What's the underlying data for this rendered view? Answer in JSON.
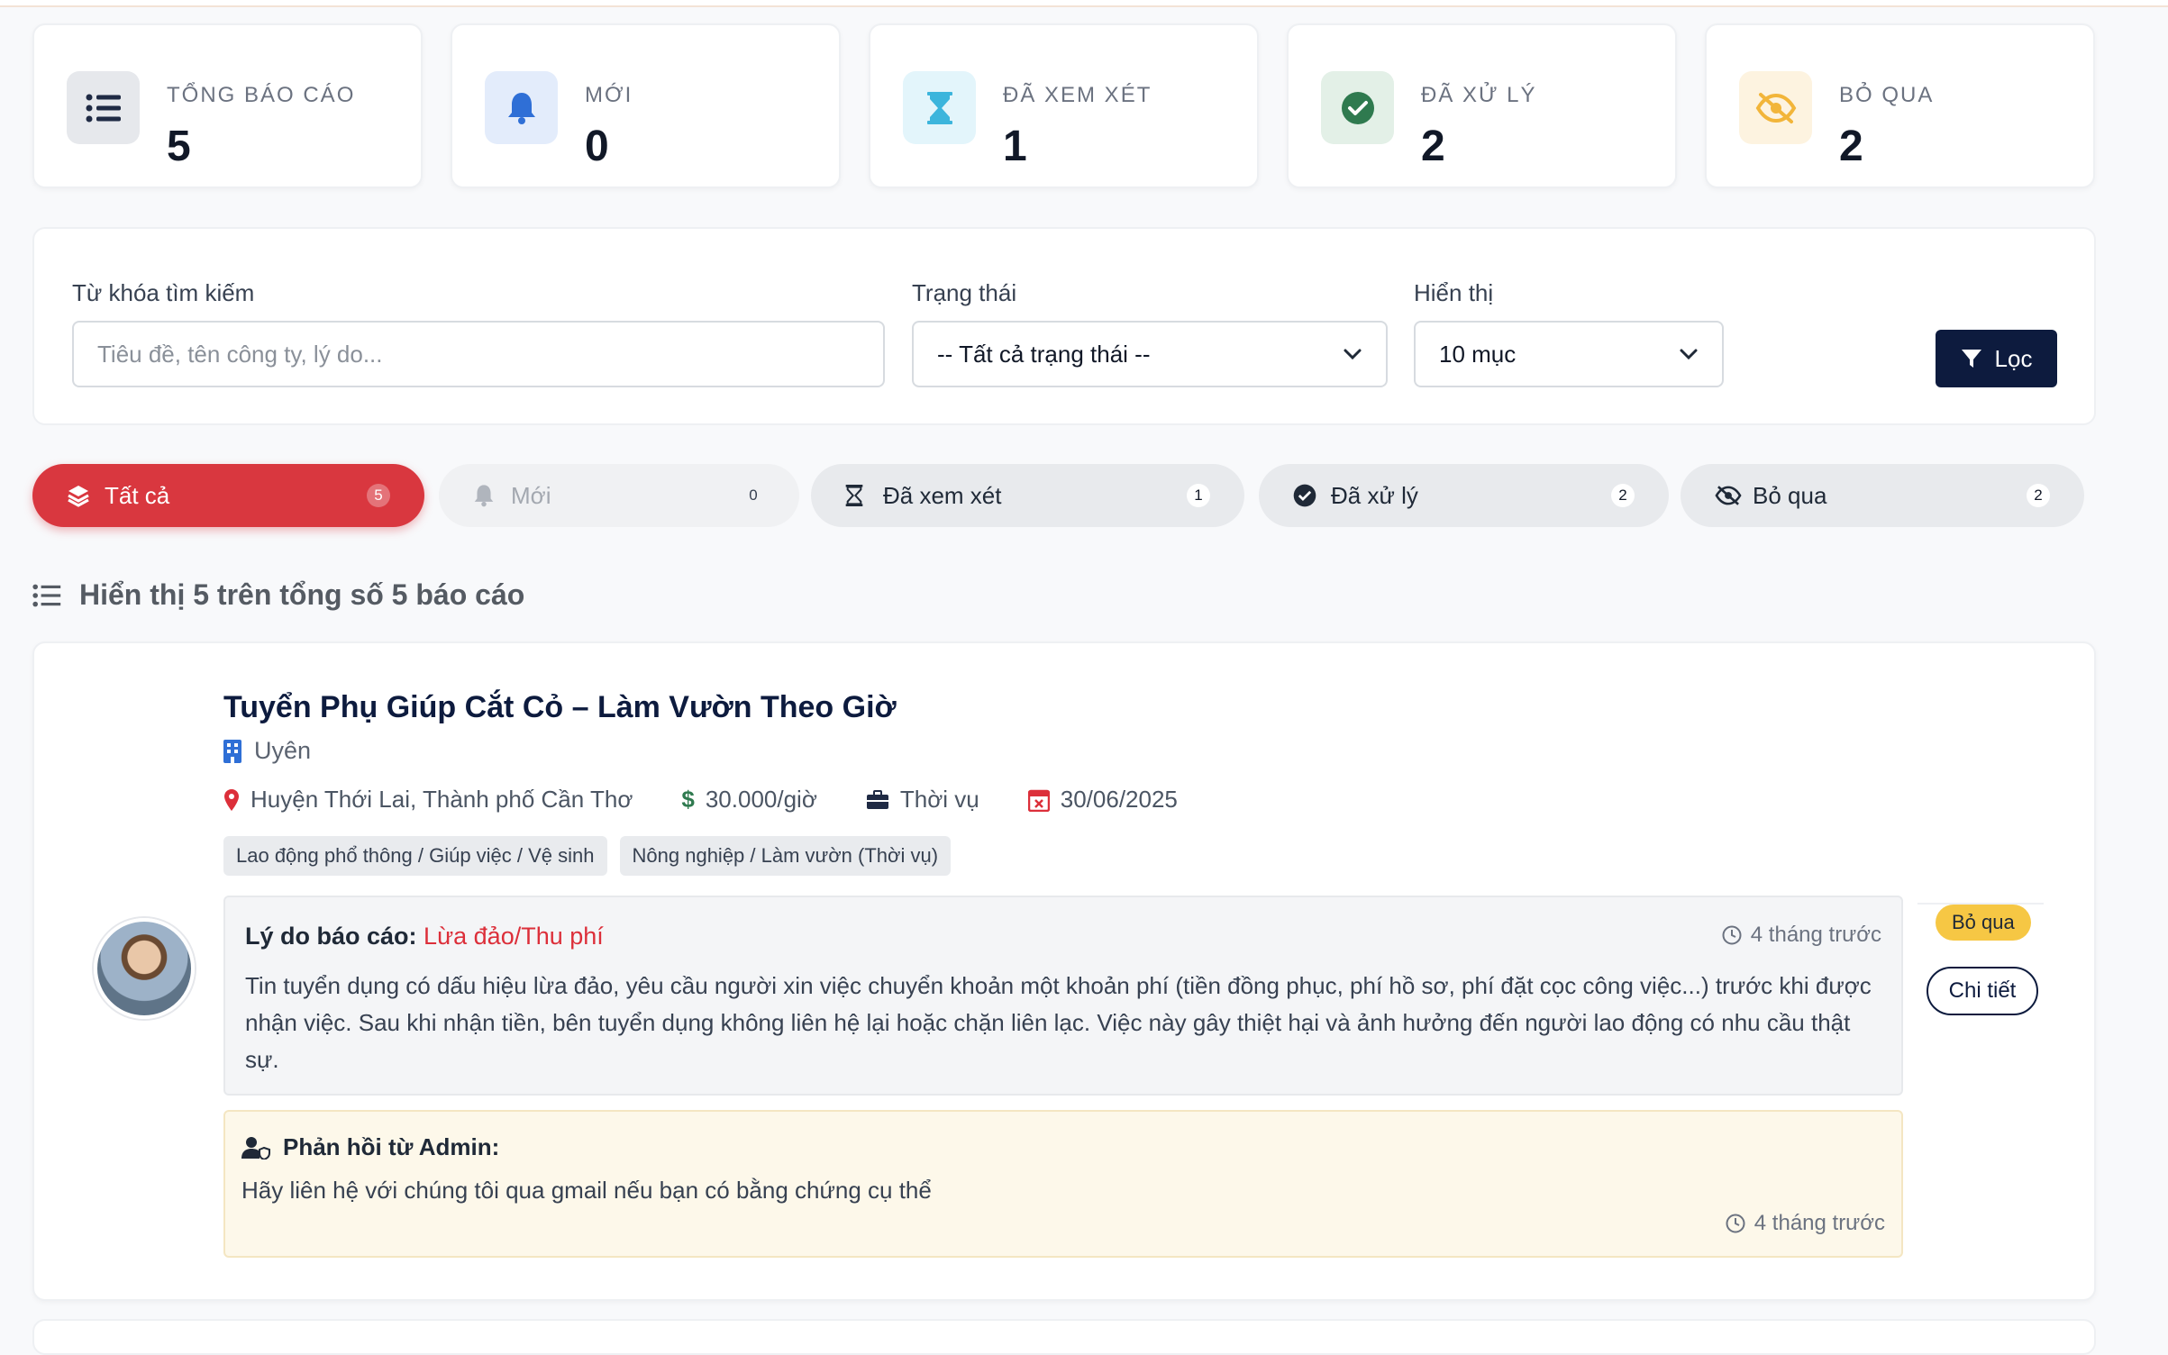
{
  "stats": [
    {
      "label": "TỔNG BÁO CÁO",
      "value": "5",
      "icon": "list-icon",
      "bg": "#e6e8ec",
      "color": "#1f2a44"
    },
    {
      "label": "MỚI",
      "value": "0",
      "icon": "bell-icon",
      "bg": "#e3ecfb",
      "color": "#2f6fd6"
    },
    {
      "label": "ĐÃ XEM XÉT",
      "value": "1",
      "icon": "hourglass-icon",
      "bg": "#e3f5fb",
      "color": "#3cb5dc"
    },
    {
      "label": "ĐÃ XỬ LÝ",
      "value": "2",
      "icon": "check-circle-icon",
      "bg": "#e3f0e7",
      "color": "#2f7a4f"
    },
    {
      "label": "BỎ QUA",
      "value": "2",
      "icon": "eye-slash-icon",
      "bg": "#fdf3e0",
      "color": "#f2b53a"
    }
  ],
  "filter": {
    "keyword_label": "Từ khóa tìm kiếm",
    "keyword_placeholder": "Tiêu đề, tên công ty, lý do...",
    "status_label": "Trạng thái",
    "status_value": "-- Tất cả trạng thái --",
    "display_label": "Hiển thị",
    "display_value": "10 mục",
    "filter_button": "Lọc"
  },
  "tabs": [
    {
      "label": "Tất cả",
      "count": "5"
    },
    {
      "label": "Mới",
      "count": "0"
    },
    {
      "label": "Đã xem xét",
      "count": "1"
    },
    {
      "label": "Đã xử lý",
      "count": "2"
    },
    {
      "label": "Bỏ qua",
      "count": "2"
    }
  ],
  "summary": "Hiển thị 5 trên tổng số 5 báo cáo",
  "report": {
    "job_title": "Tuyển Phụ Giúp Cắt Cỏ – Làm Vườn Theo Giờ",
    "company": "Uyên",
    "location": "Huyện Thới Lai, Thành phố Cần Thơ",
    "salary": "30.000/giờ",
    "job_type": "Thời vụ",
    "deadline": "30/06/2025",
    "tags": [
      "Lao động phổ thông / Giúp việc / Vệ sinh",
      "Nông nghiệp / Làm vườn (Thời vụ)"
    ],
    "reason_label": "Lý do báo cáo:",
    "reason_value": "Lừa đảo/Thu phí",
    "reason_time": "4 tháng trước",
    "reason_text": "Tin tuyển dụng có dấu hiệu lừa đảo, yêu cầu người xin việc chuyển khoản một khoản phí (tiền đồng phục, phí hồ sơ, phí đặt cọc công việc...) trước khi được nhận việc. Sau khi nhận tiền, bên tuyển dụng không liên hệ lại hoặc chặn liên lạc. Việc này gây thiệt hại và ảnh hưởng đến người lao động có nhu cầu thật sự.",
    "reply_label": "Phản hồi từ Admin:",
    "reply_text": "Hãy liên hệ với chúng tôi qua gmail nếu bạn có bằng chứng cụ thể",
    "reply_time": "4 tháng trước",
    "status_badge": "Bỏ qua",
    "detail_button": "Chi tiết"
  }
}
